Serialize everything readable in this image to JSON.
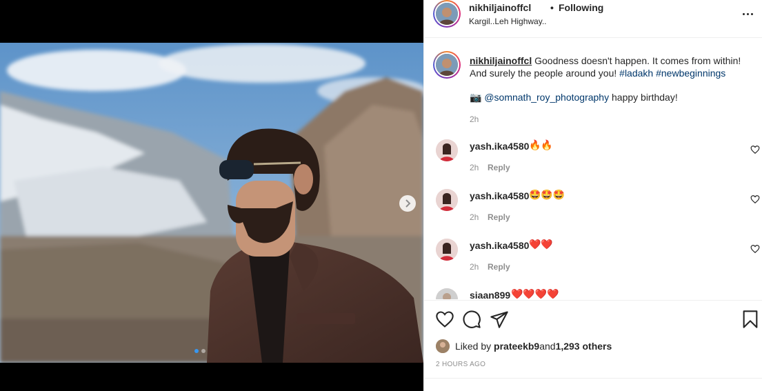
{
  "post": {
    "username": "nikhiljainoffcl",
    "separator": "•",
    "follow_status": "Following",
    "location": "Kargil..Leh Highway..",
    "more_icon": "more-horizontal-icon"
  },
  "media": {
    "next_icon": "chevron-right-icon",
    "slides_total": 2,
    "active_slide": 1
  },
  "caption": {
    "username": "nikhiljainoffcl",
    "text": " Goodness doesn't happen. It comes from within! And surely the people around you! ",
    "hashtag1": "#ladakh",
    "hashtag2": "#newbeginnings",
    "camera_emoji": "📷",
    "mention": "@somnath_roy_photography",
    "after_mention": " happy birthday!",
    "time": "2h"
  },
  "comments": [
    {
      "user": "yash.ika4580",
      "text": "🔥🔥",
      "time": "2h",
      "reply": "Reply"
    },
    {
      "user": "yash.ika4580",
      "text": "🤩🤩🤩",
      "time": "2h",
      "reply": "Reply"
    },
    {
      "user": "yash.ika4580",
      "text": "❤️❤️",
      "time": "2h",
      "reply": "Reply"
    },
    {
      "user": "siaan899",
      "text": "❤️❤️❤️❤️",
      "time": "",
      "reply": ""
    }
  ],
  "actions": {
    "like_icon": "heart-outline-icon",
    "comment_icon": "comment-icon",
    "share_icon": "send-icon",
    "save_icon": "bookmark-icon"
  },
  "likes": {
    "prefix": "Liked by ",
    "user": "prateekb9",
    "middle": " and ",
    "count": "1,293 others"
  },
  "timestamp": "2 HOURS AGO"
}
